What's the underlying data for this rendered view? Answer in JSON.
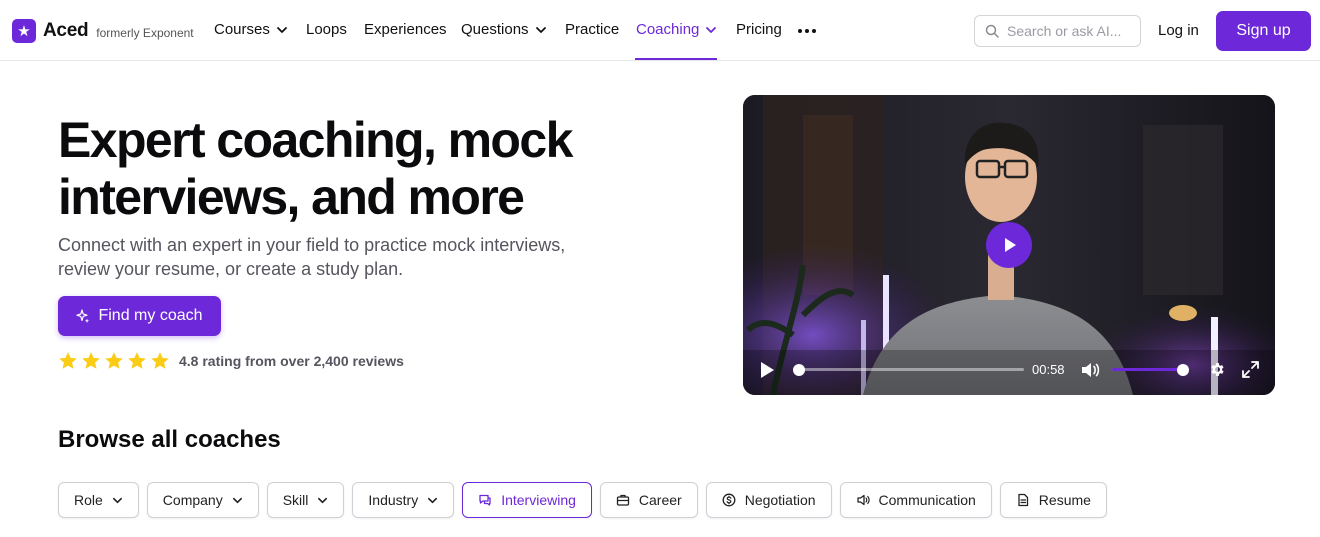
{
  "brand": {
    "name": "Aced",
    "tagline": "formerly Exponent",
    "accent": "#6d28d9"
  },
  "nav": {
    "items": [
      {
        "label": "Courses",
        "dropdown": true
      },
      {
        "label": "Loops",
        "dropdown": false
      },
      {
        "label": "Experiences",
        "dropdown": false
      },
      {
        "label": "Questions",
        "dropdown": true
      },
      {
        "label": "Practice",
        "dropdown": false
      },
      {
        "label": "Coaching",
        "dropdown": true,
        "active": true
      },
      {
        "label": "Pricing",
        "dropdown": false
      }
    ],
    "search_placeholder": "Search or ask AI...",
    "login_label": "Log in",
    "signup_label": "Sign up"
  },
  "hero": {
    "title_line1": "Expert coaching, mock",
    "title_line2": "interviews, and more",
    "subtitle_line1": "Connect with an expert in your field to practice mock interviews,",
    "subtitle_line2": "review your resume, or create a study plan.",
    "cta_label": "Find my coach",
    "rating_stars": 5,
    "rating_text": "4.8 rating from over 2,400 reviews",
    "star_color": "#facc15"
  },
  "video": {
    "time": "00:58",
    "progress_fraction": 0.0,
    "volume_fraction": 1.0
  },
  "browse": {
    "title": "Browse all coaches",
    "filters": [
      {
        "label": "Role",
        "type": "dropdown"
      },
      {
        "label": "Company",
        "type": "dropdown"
      },
      {
        "label": "Skill",
        "type": "dropdown"
      },
      {
        "label": "Industry",
        "type": "dropdown"
      },
      {
        "label": "Interviewing",
        "type": "tag",
        "icon": "chat-icon",
        "selected": true
      },
      {
        "label": "Career",
        "type": "tag",
        "icon": "briefcase-icon"
      },
      {
        "label": "Negotiation",
        "type": "tag",
        "icon": "dollar-icon"
      },
      {
        "label": "Communication",
        "type": "tag",
        "icon": "speaker-icon"
      },
      {
        "label": "Resume",
        "type": "tag",
        "icon": "document-icon"
      }
    ]
  }
}
